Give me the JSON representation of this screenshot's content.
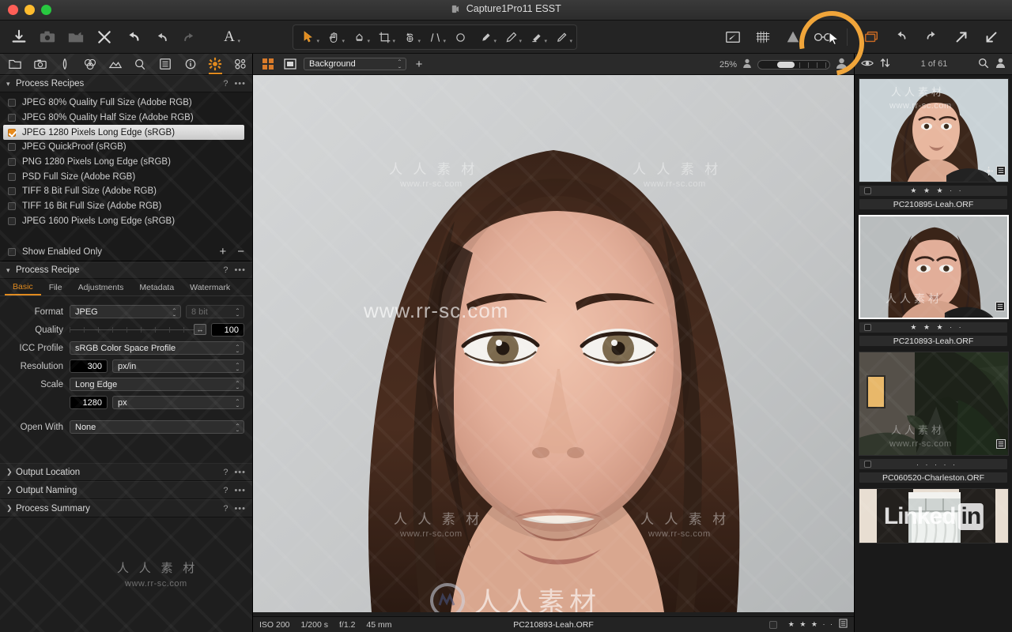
{
  "window": {
    "title": "Capture1Pro11 ESST",
    "traffic_lights": [
      "close",
      "minimize",
      "zoom"
    ]
  },
  "main_toolbar": {
    "left_tools": [
      {
        "name": "import-icon",
        "label": "Import"
      },
      {
        "name": "capture-icon",
        "label": "Capture"
      },
      {
        "name": "export-icon",
        "label": "Export"
      },
      {
        "name": "delete-icon",
        "label": "Delete"
      },
      {
        "name": "reset-icon",
        "label": "Reset"
      },
      {
        "name": "undo-icon",
        "label": "Undo"
      },
      {
        "name": "redo-icon",
        "label": "Redo"
      },
      {
        "name": "annotate-text-icon",
        "label": "Text"
      }
    ],
    "center_tools": [
      {
        "name": "select-cursor-tool",
        "label": "Select"
      },
      {
        "name": "pan-hand-tool",
        "label": "Pan"
      },
      {
        "name": "color-picker-tool",
        "label": "Picker"
      },
      {
        "name": "crop-tool",
        "label": "Crop"
      },
      {
        "name": "rotate-tool",
        "label": "Rotate"
      },
      {
        "name": "keystone-tool",
        "label": "Keystone"
      },
      {
        "name": "spot-removal-tool",
        "label": "Spot Removal"
      },
      {
        "name": "draw-mask-tool",
        "label": "Draw Mask"
      },
      {
        "name": "gradient-mask-tool",
        "label": "Gradient Mask"
      },
      {
        "name": "erase-mask-tool",
        "label": "Erase Mask"
      },
      {
        "name": "heal-brush-tool",
        "label": "Heal"
      }
    ],
    "right_tools": [
      {
        "name": "annotations-icon",
        "label": "Annotations"
      },
      {
        "name": "grid-overlay-icon",
        "label": "Grid"
      },
      {
        "name": "focus-mask-icon",
        "label": "Focus Mask"
      },
      {
        "name": "proof-preview-icon",
        "label": "Proof Preview"
      },
      {
        "name": "duplicate-variant-icon",
        "label": "Variants"
      },
      {
        "name": "rotate-left-icon",
        "label": "Rotate Left"
      },
      {
        "name": "rotate-right-icon",
        "label": "Rotate Right"
      },
      {
        "name": "expand-icon",
        "label": "Expand"
      },
      {
        "name": "collapse-icon",
        "label": "Collapse"
      }
    ],
    "highlight": {
      "target": "proof-preview-icon",
      "color": "#f0a53a"
    }
  },
  "left_panel": {
    "tool_tabs": [
      {
        "name": "library-tab",
        "label": "Library"
      },
      {
        "name": "capture-tab",
        "label": "Capture"
      },
      {
        "name": "lens-tab",
        "label": "Lens"
      },
      {
        "name": "color-tab",
        "label": "Color"
      },
      {
        "name": "exposure-tab",
        "label": "Exposure"
      },
      {
        "name": "details-tab",
        "label": "Details"
      },
      {
        "name": "adjustments-tab",
        "label": "Adjustments"
      },
      {
        "name": "metadata-tab",
        "label": "Metadata"
      },
      {
        "name": "output-tab",
        "label": "Output",
        "active": true
      },
      {
        "name": "batch-tab",
        "label": "Batch"
      }
    ],
    "process_recipes": {
      "title": "Process Recipes",
      "help": "?",
      "menu": "•••",
      "items": [
        {
          "label": "JPEG 80% Quality Full Size (Adobe RGB)",
          "checked": false,
          "selected": false
        },
        {
          "label": "JPEG 80% Quality Half Size (Adobe RGB)",
          "checked": false,
          "selected": false
        },
        {
          "label": "JPEG 1280 Pixels Long Edge (sRGB)",
          "checked": true,
          "selected": true
        },
        {
          "label": "JPEG QuickProof (sRGB)",
          "checked": false,
          "selected": false
        },
        {
          "label": "PNG 1280 Pixels Long Edge (sRGB)",
          "checked": false,
          "selected": false
        },
        {
          "label": "PSD Full Size (Adobe RGB)",
          "checked": false,
          "selected": false
        },
        {
          "label": "TIFF 8 Bit Full Size (Adobe RGB)",
          "checked": false,
          "selected": false
        },
        {
          "label": "TIFF 16 Bit Full Size (Adobe RGB)",
          "checked": false,
          "selected": false
        },
        {
          "label": "JPEG 1600 Pixels Long Edge (sRGB)",
          "checked": false,
          "selected": false
        }
      ],
      "show_enabled_only": {
        "label": "Show Enabled Only",
        "checked": false
      },
      "add_button": "+",
      "remove_button": "−"
    },
    "process_recipe": {
      "title": "Process Recipe",
      "help": "?",
      "menu": "•••",
      "tabs": [
        {
          "label": "Basic",
          "active": true
        },
        {
          "label": "File",
          "active": false
        },
        {
          "label": "Adjustments",
          "active": false
        },
        {
          "label": "Metadata",
          "active": false
        },
        {
          "label": "Watermark",
          "active": false
        }
      ],
      "fields": {
        "format_label": "Format",
        "format_value": "JPEG",
        "bit_depth_value": "8 bit",
        "quality_label": "Quality",
        "quality_value": "100",
        "icc_label": "ICC Profile",
        "icc_value": "sRGB Color Space Profile",
        "resolution_label": "Resolution",
        "resolution_value": "300",
        "resolution_unit": "px/in",
        "scale_label": "Scale",
        "scale_value": "Long Edge",
        "scale_amount": "1280",
        "scale_unit": "px",
        "open_with_label": "Open With",
        "open_with_value": "None"
      }
    },
    "collapsed_sections": [
      {
        "label": "Output Location",
        "help": "?",
        "menu": "•••"
      },
      {
        "label": "Output Naming",
        "help": "?",
        "menu": "•••"
      },
      {
        "label": "Process Summary",
        "help": "?",
        "menu": "•••"
      }
    ]
  },
  "viewer": {
    "toolbar": {
      "grid_view_icon": "grid-view-icon",
      "single_view_icon": "single-view-icon",
      "collection_value": "Background",
      "add_icon": "+",
      "zoom_level": "25%",
      "zoom_out_icon": "zoom-out-icon",
      "zoom_in_icon": "zoom-in-icon"
    },
    "status_bar": {
      "iso": "ISO 200",
      "shutter": "1/200 s",
      "aperture": "f/1.2",
      "focal": "45 mm",
      "filename": "PC210893-Leah.ORF",
      "stars": "★ ★ ★ · ·",
      "checkbox": "unchecked",
      "info_icon": "info-list-icon"
    },
    "watermarks": [
      {
        "text": "人 人 素 材",
        "type": "cn"
      },
      {
        "text": "www.rr-sc.com",
        "type": "url"
      }
    ]
  },
  "filmstrip": {
    "toolbar": {
      "eye_icon": "eye-icon",
      "sort_icon": "sort-arrows-icon",
      "count_text": "1 of 61",
      "search_icon": "search-icon",
      "user_icon": "user-icon"
    },
    "thumbnails": [
      {
        "filename": "PC210895-Leah.ORF",
        "stars": "★ ★ ★ · ·",
        "selected": false,
        "kind": "portrait-light",
        "badges": [
          "gear-icon",
          "list-icon"
        ]
      },
      {
        "filename": "PC210893-Leah.ORF",
        "stars": "★ ★ ★ · ·",
        "selected": true,
        "kind": "portrait-dark",
        "badges": [
          "list-icon"
        ]
      },
      {
        "filename": "PC060520-Charleston.ORF",
        "stars": "· · · · ·",
        "selected": false,
        "kind": "alley",
        "badges": [
          "list-icon"
        ]
      },
      {
        "filename": "",
        "stars": "",
        "selected": false,
        "kind": "window",
        "badges": [],
        "overlay_text": "Linked",
        "overlay_badge": "in"
      }
    ]
  },
  "colors": {
    "accent": "#e08a1e",
    "highlight_ring": "#f0a53a",
    "panel_bg": "#1e1e1e",
    "toolbar_bg": "#2a2a2a",
    "selected_row": "#d9d9d9"
  }
}
